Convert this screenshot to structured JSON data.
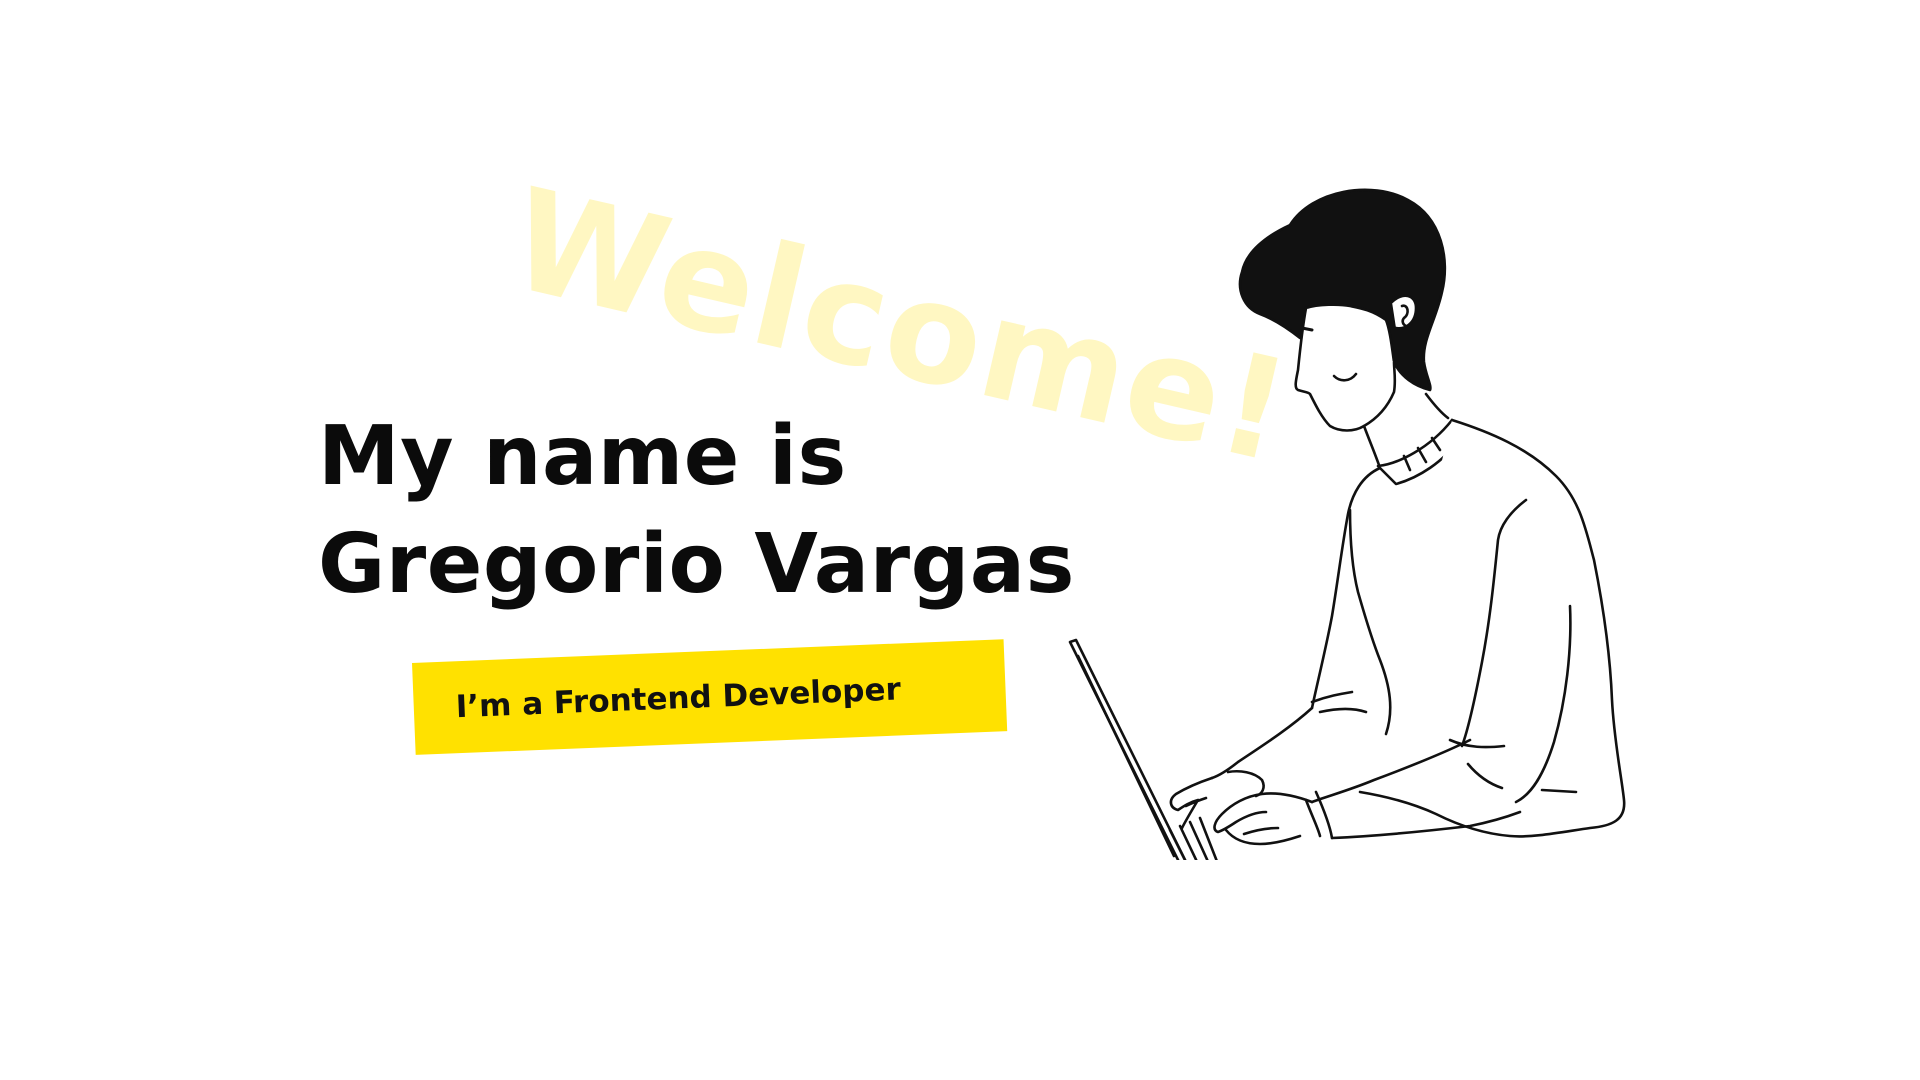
{
  "hero": {
    "welcome": "Welcome!",
    "title_line1": "My name is",
    "title_line2": "Gregorio Vargas",
    "role": "I’m a Frontend Developer"
  },
  "colors": {
    "background": "#ffffff",
    "welcome_text": "#fff7c2",
    "badge": "#ffe100",
    "text": "#0b0b0b"
  },
  "icons": {
    "illustration": "person-typing-on-laptop-illustration"
  }
}
